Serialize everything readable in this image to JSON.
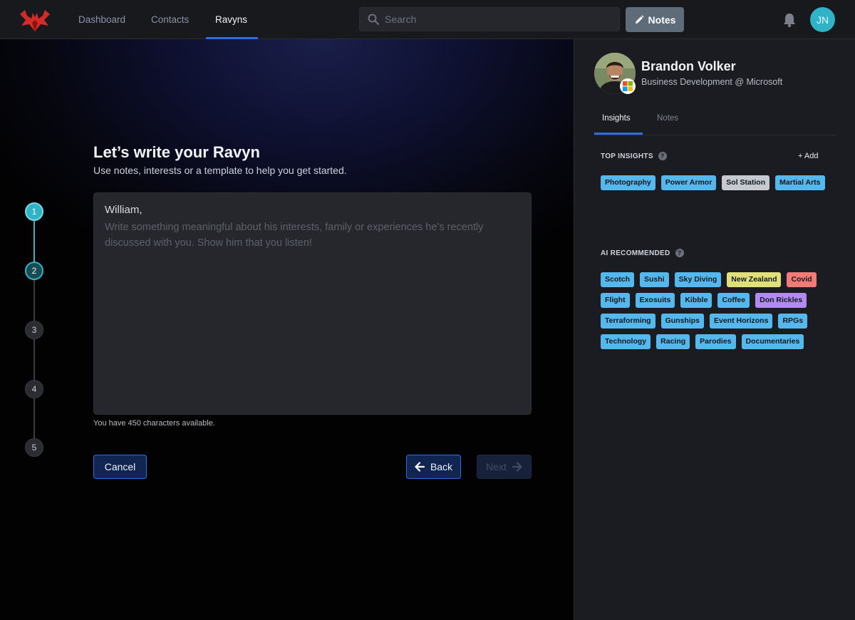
{
  "nav": {
    "links": [
      "Dashboard",
      "Contacts",
      "Ravyns"
    ],
    "active": "Ravyns",
    "search_placeholder": "Search",
    "notes_label": "Notes",
    "user_initials": "JN"
  },
  "stepper": {
    "steps": [
      "1",
      "2",
      "3",
      "4",
      "5"
    ],
    "current": 1
  },
  "composer": {
    "title": "Let’s write your Ravyn",
    "subtitle": "Use notes, interests or a template to help you get started.",
    "greeting": "William,",
    "placeholder": "Write something meaningful about his interests, family or experiences he’s recently discussed with you. Show him that you listen!",
    "char_count": "You have 450 characters available.",
    "cancel_label": "Cancel",
    "back_label": "Back",
    "next_label": "Next"
  },
  "profile": {
    "name": "Brandon Volker",
    "role": "Business Development @ Microsoft",
    "tabs": [
      "Insights",
      "Notes"
    ],
    "active_tab": "Insights"
  },
  "insights": {
    "top_heading": "TOP INSIGHTS",
    "add_label": "+ Add",
    "top": [
      {
        "label": "Photography",
        "color": "blue"
      },
      {
        "label": "Power Armor",
        "color": "blue"
      },
      {
        "label": "Sol Station",
        "color": "gray"
      },
      {
        "label": "Martial Arts",
        "color": "blue"
      }
    ],
    "ai_heading": "AI RECOMMENDED",
    "ai": [
      {
        "label": "Scotch",
        "color": "blue"
      },
      {
        "label": "Sushi",
        "color": "blue"
      },
      {
        "label": "Sky Diving",
        "color": "blue"
      },
      {
        "label": "New Zealand",
        "color": "yellow"
      },
      {
        "label": "Covid",
        "color": "red"
      },
      {
        "label": "Flight",
        "color": "blue"
      },
      {
        "label": "Exosuits",
        "color": "blue"
      },
      {
        "label": "Kibble",
        "color": "blue"
      },
      {
        "label": "Coffee",
        "color": "blue"
      },
      {
        "label": "Don Rickles",
        "color": "purple"
      },
      {
        "label": "Terraforming",
        "color": "blue"
      },
      {
        "label": "Gunships",
        "color": "blue"
      },
      {
        "label": "Event Horizons",
        "color": "blue"
      },
      {
        "label": "RPGs",
        "color": "blue"
      },
      {
        "label": "Technology",
        "color": "blue"
      },
      {
        "label": "Racing",
        "color": "blue"
      },
      {
        "label": "Parodies",
        "color": "blue"
      },
      {
        "label": "Documentaries",
        "color": "blue"
      }
    ]
  },
  "colors": {
    "accent": "#2f6ee0",
    "teal": "#2fb3c7",
    "tag_blue": "#55b8ec",
    "tag_yellow": "#dfe07a",
    "tag_red": "#f07b77",
    "tag_purple": "#b28bf0",
    "tag_gray": "#c5c9d0"
  }
}
